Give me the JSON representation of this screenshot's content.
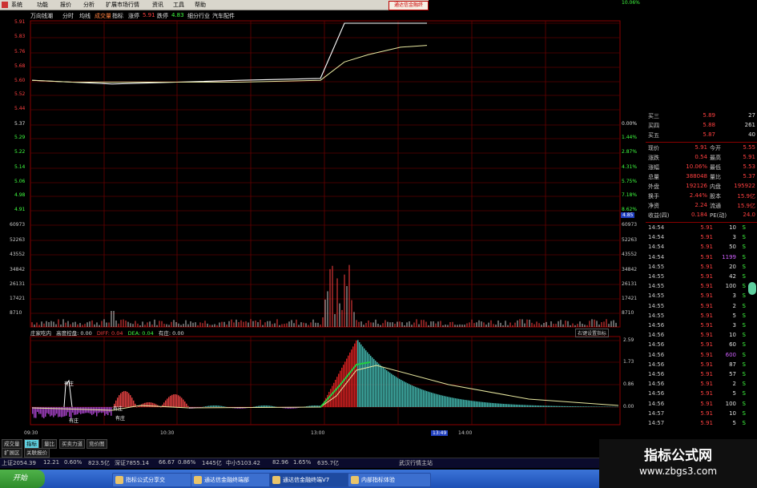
{
  "menu": {
    "items": [
      "系统",
      "功能",
      "报价",
      "分析",
      "扩展市场行情",
      "资讯",
      "工具",
      "帮助"
    ],
    "brand": "通达信金融终"
  },
  "header": {
    "stock_name": "万向钱潮",
    "view": "分时",
    "avg_label": "均线",
    "vol_label": "成交量",
    "index_label": "指标",
    "up_stop_label": "涨停",
    "up_stop_value": "5.91",
    "down_stop_label": "跌停",
    "down_stop_value": "4.83",
    "sector_label": "细分行业",
    "sector_value": "汽车配件"
  },
  "price_axis": [
    "5.91",
    "5.83",
    "5.76",
    "5.68",
    "5.60",
    "5.52",
    "5.44",
    "5.37",
    "5.29",
    "5.22",
    "5.14",
    "5.06",
    "4.98",
    "4.91"
  ],
  "pct_axis": [
    "0.00%",
    "1.44%",
    "2.87%",
    "4.31%",
    "5.75%",
    "7.18%",
    "8.62%",
    "10.06%"
  ],
  "current_price_tag": "4.85",
  "volume_axis": [
    "60973",
    "52263",
    "43552",
    "34842",
    "26131",
    "17421",
    "8710"
  ],
  "indicator": {
    "name": "庄家吃内",
    "title": "高度控盘: 0.00",
    "diff": "DIFF: 0.04",
    "dea": "DEA: 0.04",
    "zhuang": "有庄: 0.00",
    "right_button": "右键设置指标",
    "axis": [
      "2.59",
      "1.73",
      "0.86",
      "0.00"
    ],
    "markers": [
      "有庄",
      "有庄",
      "有庄",
      "有庄"
    ]
  },
  "time_axis": {
    "labels": [
      "09:30",
      "10:30",
      "13:00",
      "14:00"
    ],
    "cursor": "13:49"
  },
  "chart_data": {
    "type": "line",
    "x": [
      "09:30",
      "10:00",
      "10:30",
      "11:00",
      "11:30",
      "13:00",
      "13:10",
      "13:30",
      "14:00",
      "14:30",
      "15:00"
    ],
    "series": [
      {
        "values": [
          5.6,
          5.59,
          5.58,
          5.59,
          5.6,
          5.61,
          5.91,
          5.91,
          5.91,
          5.91,
          5.91
        ]
      },
      {
        "values": [
          5.6,
          5.59,
          5.59,
          5.59,
          5.59,
          5.6,
          5.7,
          5.74,
          5.76,
          5.78,
          5.79
        ]
      }
    ],
    "ylim": [
      5.44,
      5.91
    ]
  },
  "quote": {
    "bids": [
      {
        "label": "买三",
        "price": "5.89",
        "vol": "27"
      },
      {
        "label": "买四",
        "price": "5.88",
        "vol": "261"
      },
      {
        "label": "买五",
        "price": "5.87",
        "vol": "40"
      }
    ],
    "stats": [
      {
        "l1": "现价",
        "v1": "5.91",
        "l2": "今开",
        "v2": "5.55"
      },
      {
        "l1": "涨跌",
        "v1": "0.54",
        "l2": "最高",
        "v2": "5.91"
      },
      {
        "l1": "涨幅",
        "v1": "10.06%",
        "l2": "最低",
        "v2": "5.53"
      },
      {
        "l1": "总量",
        "v1": "388048",
        "l2": "量比",
        "v2": "5.37"
      },
      {
        "l1": "外盘",
        "v1": "192126",
        "l2": "内盘",
        "v2": "195922"
      },
      {
        "l1": "换手",
        "v1": "2.44%",
        "l2": "股本",
        "v2": "15.9亿"
      },
      {
        "l1": "净资",
        "v1": "2.24",
        "l2": "流通",
        "v2": "15.9亿"
      },
      {
        "l1": "收益(四)",
        "v1": "0.184",
        "l2": "PE(动)",
        "v2": "24.0"
      }
    ],
    "ticks": [
      {
        "t": "14:54",
        "p": "5.91",
        "v": "10",
        "s": "S"
      },
      {
        "t": "14:54",
        "p": "5.91",
        "v": "3",
        "s": "S"
      },
      {
        "t": "14:54",
        "p": "5.91",
        "v": "50",
        "s": "S"
      },
      {
        "t": "14:54",
        "p": "5.91",
        "v": "1199",
        "s": "S"
      },
      {
        "t": "14:55",
        "p": "5.91",
        "v": "20",
        "s": "S"
      },
      {
        "t": "14:55",
        "p": "5.91",
        "v": "42",
        "s": "S"
      },
      {
        "t": "14:55",
        "p": "5.91",
        "v": "100",
        "s": "S"
      },
      {
        "t": "14:55",
        "p": "5.91",
        "v": "3",
        "s": "S"
      },
      {
        "t": "14:55",
        "p": "5.91",
        "v": "2",
        "s": "S"
      },
      {
        "t": "14:55",
        "p": "5.91",
        "v": "5",
        "s": "S"
      },
      {
        "t": "14:56",
        "p": "5.91",
        "v": "3",
        "s": "S"
      },
      {
        "t": "14:56",
        "p": "5.91",
        "v": "10",
        "s": "S"
      },
      {
        "t": "14:56",
        "p": "5.91",
        "v": "60",
        "s": "S"
      },
      {
        "t": "14:56",
        "p": "5.91",
        "v": "600",
        "s": "S"
      },
      {
        "t": "14:56",
        "p": "5.91",
        "v": "87",
        "s": "S"
      },
      {
        "t": "14:56",
        "p": "5.91",
        "v": "57",
        "s": "S"
      },
      {
        "t": "14:56",
        "p": "5.91",
        "v": "2",
        "s": "S"
      },
      {
        "t": "14:56",
        "p": "5.91",
        "v": "5",
        "s": "S"
      },
      {
        "t": "14:56",
        "p": "5.91",
        "v": "100",
        "s": "S"
      },
      {
        "t": "14:57",
        "p": "5.91",
        "v": "10",
        "s": "S"
      },
      {
        "t": "14:57",
        "p": "5.91",
        "v": "5",
        "s": "S"
      }
    ]
  },
  "bottom_tabs": [
    "成交量",
    "指标",
    "量比",
    "买卖力道",
    "竞价图"
  ],
  "ext_tabs": [
    "扩展区",
    "关联报价"
  ],
  "status": [
    {
      "text": "上证2054.39",
      "color": "#ff4040"
    },
    {
      "text": "12.21",
      "color": "#ff4040"
    },
    {
      "text": "0.60%",
      "color": "#ff4040"
    },
    {
      "text": "823.5亿",
      "color": "#c8c8c8"
    },
    {
      "text": "深证7855.14",
      "color": "#ff4040"
    },
    {
      "text": "66.67",
      "color": "#ff4040"
    },
    {
      "text": "0.86%",
      "color": "#ff4040"
    },
    {
      "text": "1445亿",
      "color": "#c8c8c8"
    },
    {
      "text": "中小5103.42",
      "color": "#ff4040"
    },
    {
      "text": "82.96",
      "color": "#ff4040"
    },
    {
      "text": "1.65%",
      "color": "#ff4040"
    },
    {
      "text": "635.7亿",
      "color": "#c8c8c8"
    },
    {
      "text": "武汉行情主站",
      "color": "#e0e0e0"
    }
  ],
  "taskbar": {
    "start": "开始",
    "items": [
      "指标公式分享交",
      "通达信金融终端部",
      "通达信金融终端V7",
      "内部指标体验"
    ]
  },
  "watermark": {
    "line1": "指标公式网",
    "line2": "www.zbgs3.com"
  }
}
